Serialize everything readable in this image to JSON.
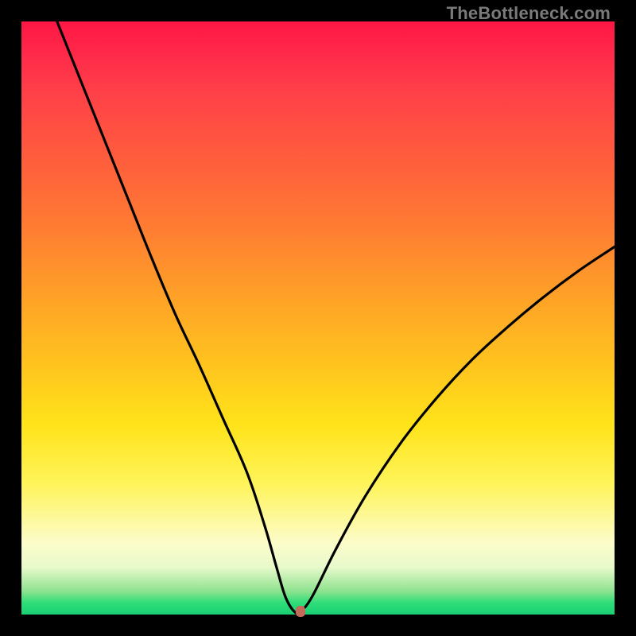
{
  "watermark": "TheBottleneck.com",
  "chart_data": {
    "type": "line",
    "title": "",
    "xlabel": "",
    "ylabel": "",
    "xlim": [
      0,
      100
    ],
    "ylim": [
      0,
      100
    ],
    "grid": false,
    "legend": false,
    "series": [
      {
        "name": "curve",
        "x": [
          6,
          10,
          14,
          18,
          22,
          26,
          30,
          34,
          38,
          41,
          43,
          44.5,
          46,
          47,
          49,
          53,
          58,
          64,
          70,
          76,
          82,
          88,
          94,
          100
        ],
        "y": [
          100,
          90,
          80,
          70,
          60,
          50.5,
          42,
          33,
          24,
          15,
          8,
          3,
          0.5,
          0.5,
          3,
          11,
          20,
          29,
          36.5,
          43,
          48.5,
          53.5,
          58,
          62
        ]
      }
    ],
    "marker": {
      "x": 47,
      "y": 0.6
    },
    "background_gradient": {
      "top_color": "#ff1744",
      "bottom_color": "#19cf72"
    }
  }
}
